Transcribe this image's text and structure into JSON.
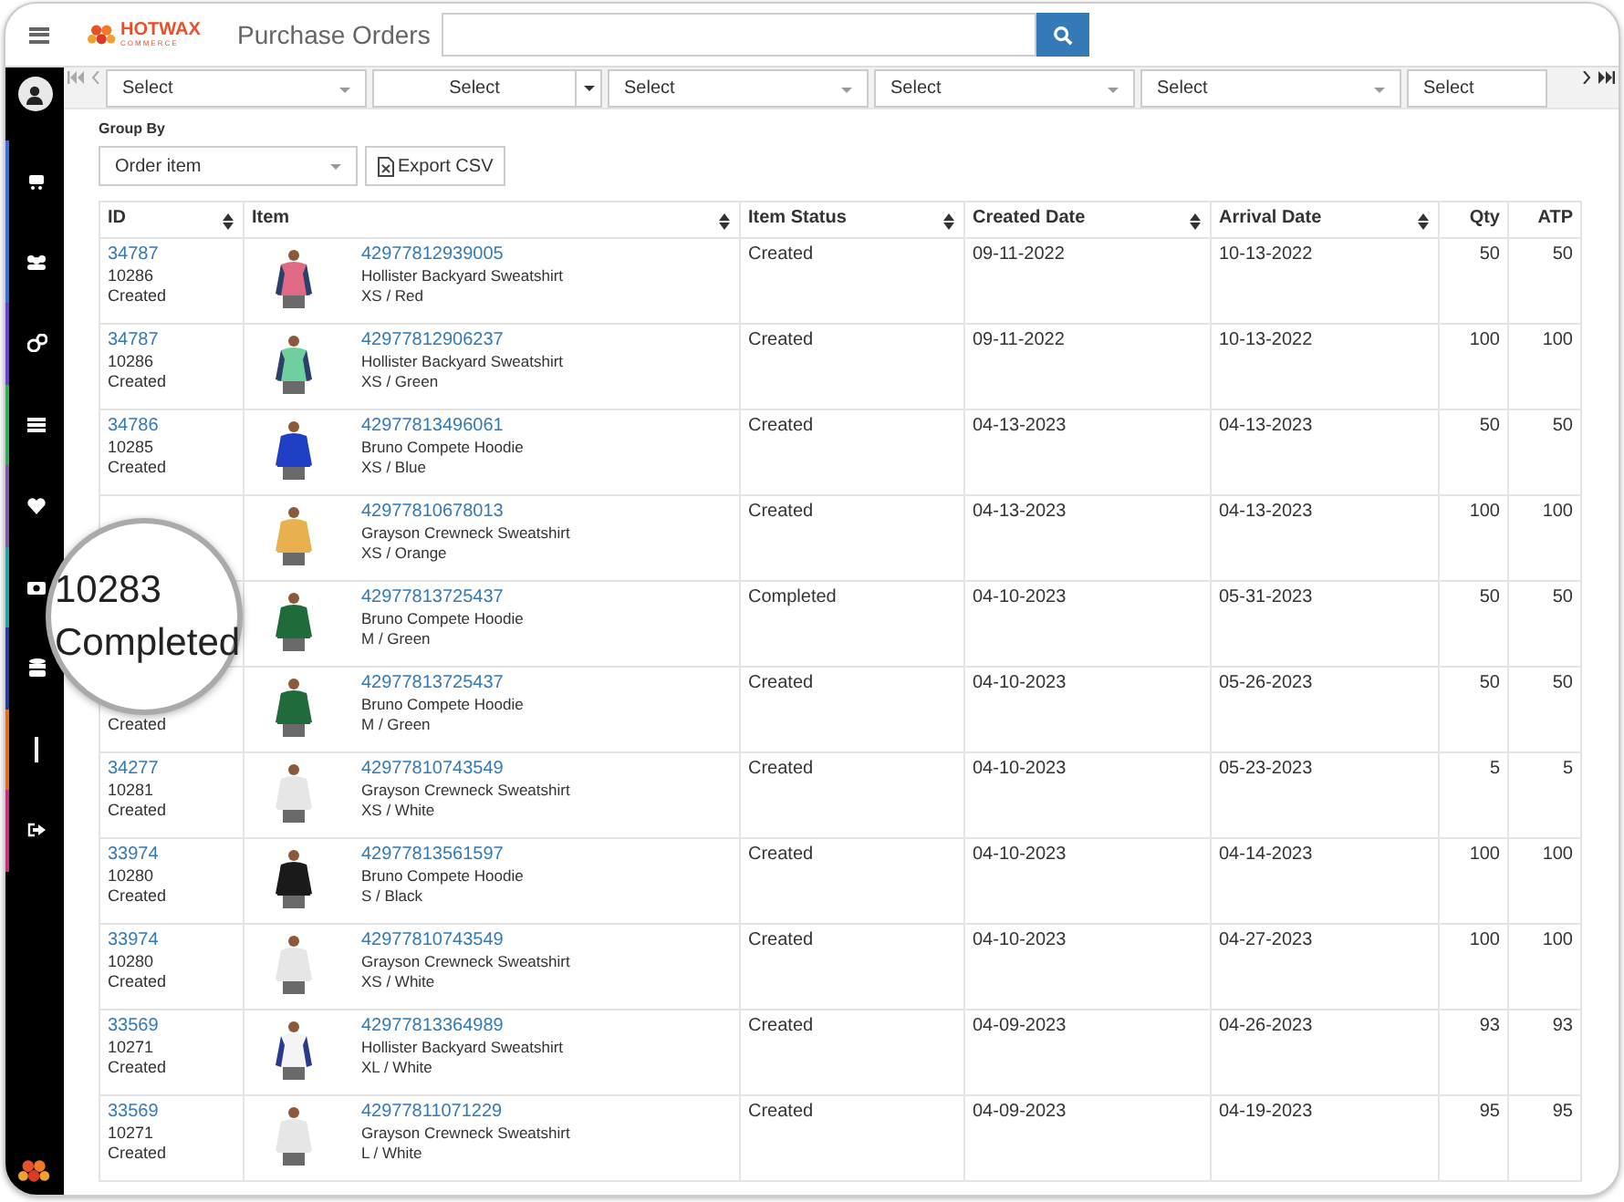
{
  "header": {
    "title": "Purchase Orders",
    "logo": {
      "name": "HOTWAX",
      "sub": "COMMERCE"
    }
  },
  "filters": [
    {
      "label": "Select",
      "kind": "dropdown"
    },
    {
      "label": "Select",
      "kind": "split"
    },
    {
      "label": "Select",
      "kind": "dropdown"
    },
    {
      "label": "Select",
      "kind": "dropdown"
    },
    {
      "label": "Select",
      "kind": "dropdown"
    },
    {
      "label": "Select",
      "kind": "plain"
    }
  ],
  "group_by": {
    "label": "Group By",
    "value": "Order item"
  },
  "export_button": "Export CSV",
  "table": {
    "columns": [
      {
        "label": "ID",
        "sortable": true,
        "kind": "text"
      },
      {
        "label": "Item",
        "sortable": true,
        "kind": "text"
      },
      {
        "label": "Item Status",
        "sortable": true,
        "kind": "text"
      },
      {
        "label": "Created Date",
        "sortable": true,
        "kind": "text"
      },
      {
        "label": "Arrival Date",
        "sortable": true,
        "kind": "text"
      },
      {
        "label": "Qty",
        "sortable": false,
        "kind": "number"
      },
      {
        "label": "ATP",
        "sortable": false,
        "kind": "number"
      }
    ],
    "rows": [
      {
        "id": "34787",
        "po": "10286",
        "id_status": "Created",
        "sku": "42977812939005",
        "product": "Hollister Backyard Sweatshirt",
        "variant": "XS / Red",
        "status": "Created",
        "created": "09-11-2022",
        "arrival": "10-13-2022",
        "qty": "50",
        "atp": "50"
      },
      {
        "id": "34787",
        "po": "10286",
        "id_status": "Created",
        "sku": "42977812906237",
        "product": "Hollister Backyard Sweatshirt",
        "variant": "XS / Green",
        "status": "Created",
        "created": "09-11-2022",
        "arrival": "10-13-2022",
        "qty": "100",
        "atp": "100"
      },
      {
        "id": "34786",
        "po": "10285",
        "id_status": "Created",
        "sku": "42977813496061",
        "product": "Bruno Compete Hoodie",
        "variant": "XS / Blue",
        "status": "Created",
        "created": "04-13-2023",
        "arrival": "04-13-2023",
        "qty": "50",
        "atp": "50"
      },
      {
        "sku": "42977810678013",
        "product": "Grayson Crewneck Sweatshirt",
        "variant": "XS / Orange",
        "status": "Created",
        "created": "04-13-2023",
        "arrival": "04-13-2023",
        "qty": "100",
        "atp": "100"
      },
      {
        "sku": "42977813725437",
        "product": "Bruno Compete Hoodie",
        "variant": "M / Green",
        "status": "Completed",
        "created": "04-10-2023",
        "arrival": "05-31-2023",
        "qty": "50",
        "atp": "50"
      },
      {
        "id_status": "Created",
        "sku": "42977813725437",
        "product": "Bruno Compete Hoodie",
        "variant": "M / Green",
        "status": "Created",
        "created": "04-10-2023",
        "arrival": "05-26-2023",
        "qty": "50",
        "atp": "50"
      },
      {
        "id": "34277",
        "po": "10281",
        "id_status": "Created",
        "sku": "42977810743549",
        "product": "Grayson Crewneck Sweatshirt",
        "variant": "XS / White",
        "status": "Created",
        "created": "04-10-2023",
        "arrival": "05-23-2023",
        "qty": "5",
        "atp": "5"
      },
      {
        "id": "33974",
        "po": "10280",
        "id_status": "Created",
        "sku": "42977813561597",
        "product": "Bruno Compete Hoodie",
        "variant": "S / Black",
        "status": "Created",
        "created": "04-10-2023",
        "arrival": "04-14-2023",
        "qty": "100",
        "atp": "100"
      },
      {
        "id": "33974",
        "po": "10280",
        "id_status": "Created",
        "sku": "42977810743549",
        "product": "Grayson Crewneck Sweatshirt",
        "variant": "XS / White",
        "status": "Created",
        "created": "04-10-2023",
        "arrival": "04-27-2023",
        "qty": "100",
        "atp": "100"
      },
      {
        "id": "33569",
        "po": "10271",
        "id_status": "Created",
        "sku": "42977813364989",
        "product": "Hollister Backyard Sweatshirt",
        "variant": "XL / White",
        "status": "Created",
        "created": "04-09-2023",
        "arrival": "04-26-2023",
        "qty": "93",
        "atp": "93"
      },
      {
        "id": "33569",
        "po": "10271",
        "id_status": "Created",
        "sku": "42977811071229",
        "product": "Grayson Crewneck Sweatshirt",
        "variant": "L / White",
        "status": "Created",
        "created": "04-09-2023",
        "arrival": "04-19-2023",
        "qty": "95",
        "atp": "95"
      }
    ]
  },
  "magnifier": {
    "lines": [
      "10283",
      "Completed"
    ]
  }
}
